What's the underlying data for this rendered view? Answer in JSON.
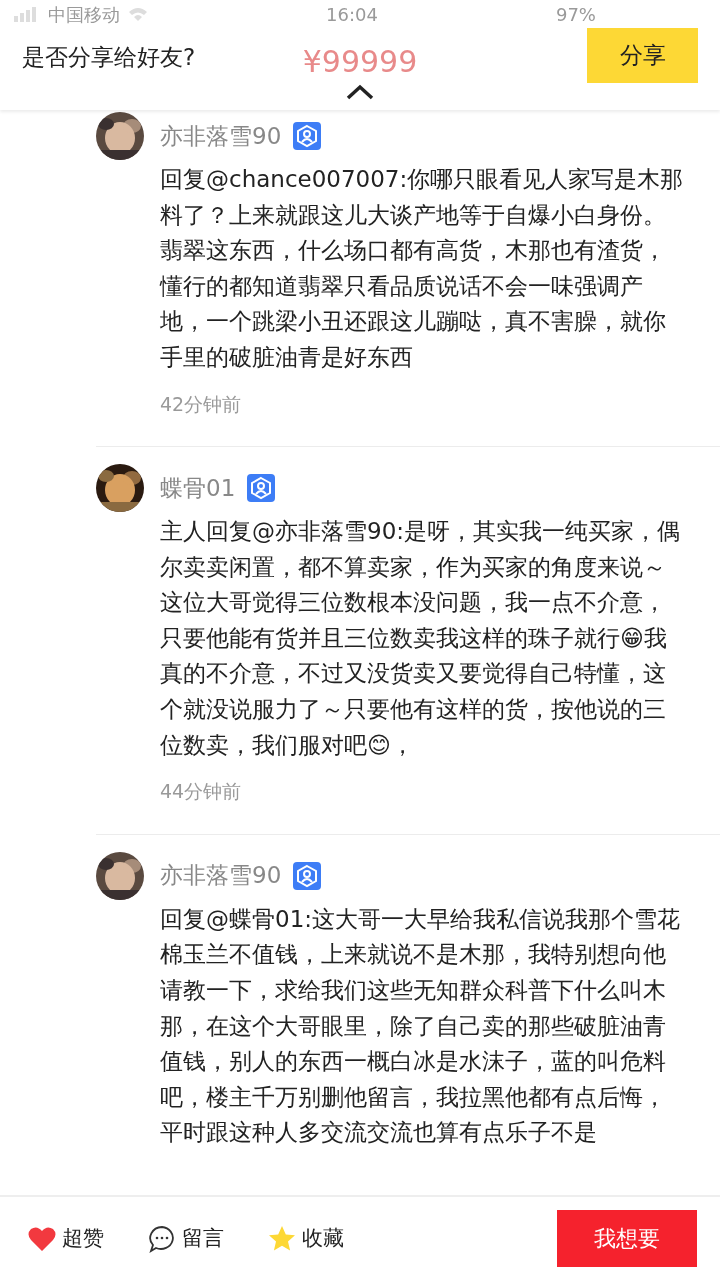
{
  "status_bar": {
    "carrier": "中国移动",
    "time": "16:04",
    "battery": "97%"
  },
  "header": {
    "price": "¥99999"
  },
  "share_banner": {
    "prompt": "是否分享给好友?",
    "button": "分享"
  },
  "comments": [
    {
      "author": "亦非落雪90",
      "text": "回复@chance007007:你哪只眼看见人家写是木那料了？上来就跟这儿大谈产地等于自爆小白身份。翡翠这东西，什么场口都有高货，木那也有渣货，懂行的都知道翡翠只看品质说话不会一味强调产地，一个跳梁小丑还跟这儿蹦哒，真不害臊，就你手里的破脏油青是好东西",
      "time": "42分钟前"
    },
    {
      "author": "蝶骨01",
      "text": "主人回复@亦非落雪90:是呀，其实我一纯买家，偶尔卖卖闲置，都不算卖家，作为买家的角度来说～这位大哥觉得三位数根本没问题，我一点不介意，只要他能有货并且三位数卖我这样的珠子就行😁我真的不介意，不过又没货卖又要觉得自己特懂，这个就没说服力了～只要他有这样的货，按他说的三位数卖，我们服对吧😊，",
      "time": "44分钟前"
    },
    {
      "author": "亦非落雪90",
      "text": "回复@蝶骨01:这大哥一大早给我私信说我那个雪花棉玉兰不值钱，上来就说不是木那，我特别想向他请教一下，求给我们这些无知群众科普下什么叫木那，在这个大哥眼里，除了自己卖的那些破脏油青值钱，别人的东西一概白冰是水沫子，蓝的叫危料吧，楼主千万别删他留言，我拉黑他都有点后悔，平时跟这种人多交流交流也算有点乐子不是"
    }
  ],
  "bottom_bar": {
    "actions": [
      {
        "kind": "like",
        "label": "超赞"
      },
      {
        "kind": "comment",
        "label": "留言"
      },
      {
        "kind": "favorite",
        "label": "收藏"
      }
    ],
    "buy_button": "我想要"
  }
}
